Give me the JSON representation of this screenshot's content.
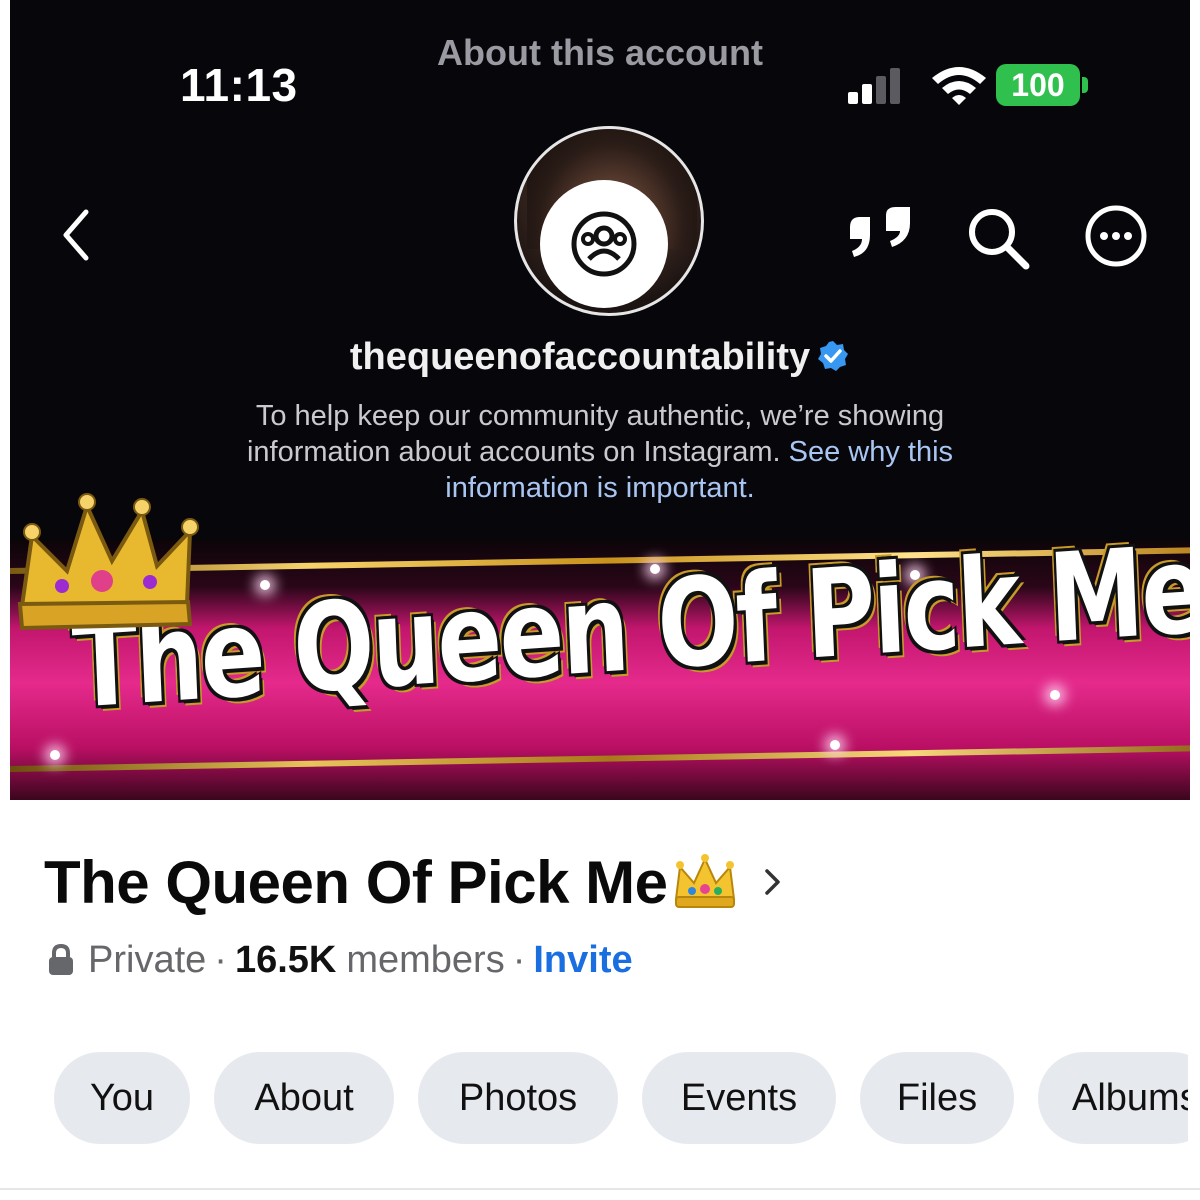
{
  "status_bar": {
    "time": "11:13",
    "battery": "100"
  },
  "sheet": {
    "title": "About this account"
  },
  "account": {
    "username": "thequeenofaccountability",
    "info_text": "To help keep our community authentic, we’re showing information about accounts on Instagram.",
    "info_link": "See why this information is important."
  },
  "banner": {
    "title": "The Queen Of Pick Me!"
  },
  "group": {
    "name": "The Queen Of Pick Me",
    "privacy": "Private",
    "members_count": "16.5K",
    "members_label": "members",
    "invite": "Invite",
    "separator": "·"
  },
  "tabs": [
    "You",
    "About",
    "Photos",
    "Events",
    "Files",
    "Albums"
  ],
  "colors": {
    "cover_bg": "#07070b",
    "banner_pink": "#e52a8c",
    "battery_green": "#30c04e",
    "link_blue": "#1a6ee0",
    "tab_bg": "#e6e9ee"
  },
  "icons": [
    "back-icon",
    "quote-icon",
    "search-icon",
    "more-icon",
    "verified-icon",
    "lock-icon",
    "crown-emoji-icon",
    "chevron-right-icon",
    "signal-icon",
    "wifi-icon",
    "battery-icon"
  ]
}
